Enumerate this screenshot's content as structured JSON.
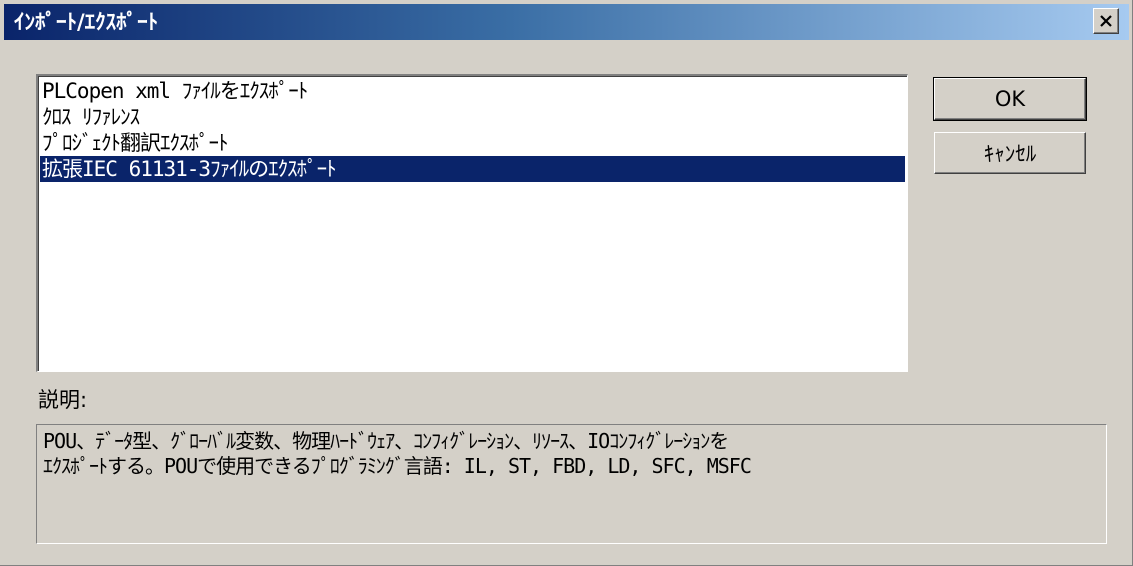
{
  "window": {
    "title": "ｲﾝﾎﾟｰﾄ/ｴｸｽﾎﾟｰﾄ",
    "close_icon": "close-icon"
  },
  "list": {
    "items": [
      {
        "label": "PLCopen xml ﾌｧｲﾙをｴｸｽﾎﾟｰﾄ",
        "selected": false
      },
      {
        "label": "ｸﾛｽ ﾘﾌｧﾚﾝｽ",
        "selected": false
      },
      {
        "label": "ﾌﾟﾛｼﾞｪｸﾄ翻訳ｴｸｽﾎﾟｰﾄ",
        "selected": false
      },
      {
        "label": "拡張IEC 61131-3ﾌｧｲﾙのｴｸｽﾎﾟｰﾄ",
        "selected": true
      }
    ]
  },
  "buttons": {
    "ok_label": "OK",
    "cancel_label": "ｷｬﾝｾﾙ"
  },
  "description": {
    "label": "説明:",
    "lines": [
      "POU、ﾃﾞｰﾀ型、ｸﾞﾛｰﾊﾞﾙ変数、物理ﾊｰﾄﾞｳｪｱ、ｺﾝﾌｨｸﾞﾚｰｼｮﾝ、ﾘｿｰｽ、IOｺﾝﾌｨｸﾞﾚｰｼｮﾝを",
      "ｴｸｽﾎﾟｰﾄする。POUで使用できるﾌﾟﾛｸﾞﾗﾐﾝｸﾞ言語: IL, ST, FBD, LD, SFC, MSFC"
    ]
  },
  "colors": {
    "selection": "#0a246a",
    "title_gradient_start": "#0a246a",
    "title_gradient_end": "#a6caf0",
    "face": "#d4d0c8"
  }
}
